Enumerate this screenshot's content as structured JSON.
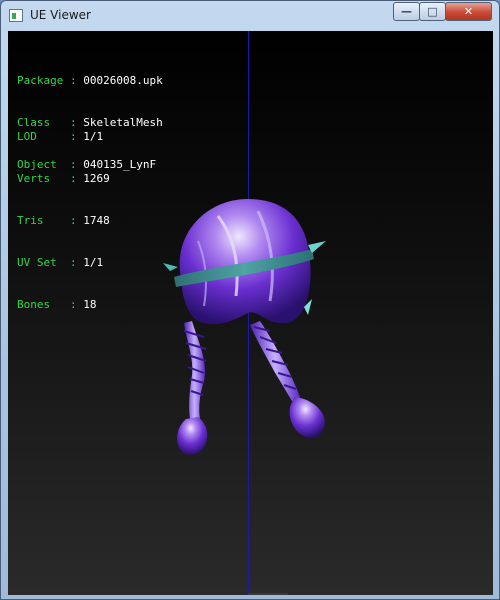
{
  "window": {
    "title": "UE Viewer",
    "minimize_glyph": "—",
    "maximize_glyph": "□",
    "close_glyph": "✕"
  },
  "info": {
    "header": [
      {
        "key": "Package",
        "value": "00026008.upk"
      },
      {
        "key": "Class  ",
        "value": "SkeletalMesh"
      },
      {
        "key": "Object ",
        "value": "040135_LynF"
      }
    ],
    "stats": [
      {
        "key": "LOD    ",
        "value": "1/1"
      },
      {
        "key": "Verts  ",
        "value": "1269"
      },
      {
        "key": "Tris   ",
        "value": "1748"
      },
      {
        "key": "UV Set ",
        "value": "1/1"
      },
      {
        "key": "Bones  ",
        "value": "18"
      }
    ],
    "separator": " : "
  },
  "colors": {
    "label": "#33d649",
    "value": "#ffffff",
    "axis": "#1b1ba6",
    "hair_primary": "#7a3fd8",
    "hair_highlight": "#d8c8ff",
    "band": "#3f8c8c"
  }
}
